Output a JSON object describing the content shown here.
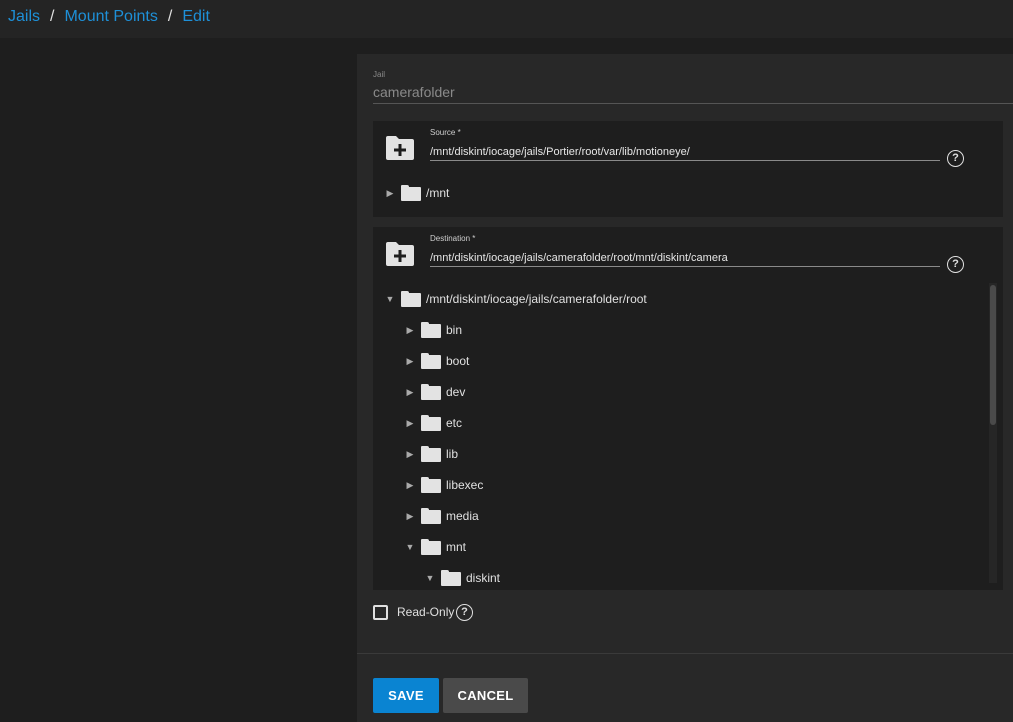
{
  "breadcrumb": {
    "items": [
      "Jails",
      "Mount Points",
      "Edit"
    ]
  },
  "jail": {
    "label": "Jail",
    "value": "camerafolder"
  },
  "source": {
    "label": "Source *",
    "value": "/mnt/diskint/iocage/jails/Portier/root/var/lib/motioneye/",
    "tree_root": "/mnt"
  },
  "destination": {
    "label": "Destination *",
    "value": "/mnt/diskint/iocage/jails/camerafolder/root/mnt/diskint/camera",
    "tree_root": "/mnt/diskint/iocage/jails/camerafolder/root",
    "children": [
      "bin",
      "boot",
      "dev",
      "etc",
      "lib",
      "libexec",
      "media",
      "mnt"
    ],
    "grandchild": "diskint"
  },
  "readonly": {
    "label": "Read-Only",
    "checked": false
  },
  "buttons": {
    "save": "SAVE",
    "cancel": "CANCEL"
  },
  "icons": {
    "help": "?"
  },
  "colors": {
    "accent": "#0a84d2",
    "link": "#1e90d8"
  }
}
